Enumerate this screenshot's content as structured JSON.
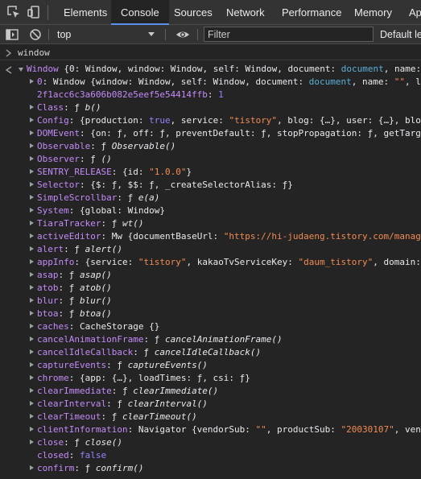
{
  "tabs": {
    "elements": "Elements",
    "console": "Console",
    "sources": "Sources",
    "network": "Network",
    "performance": "Performance",
    "memory": "Memory",
    "application": "Ap"
  },
  "toolbar": {
    "context": "top",
    "filter_placeholder": "Filter",
    "levels": "Default le"
  },
  "command": "window",
  "rows": [
    {
      "indent": 0,
      "arrow": "down",
      "segments": [
        [
          "kd",
          "Window "
        ],
        [
          "p",
          "{0: Window, window: Window, self: Window, document: "
        ],
        [
          "kw",
          "document"
        ],
        [
          "p",
          ", name: "
        ]
      ]
    },
    {
      "indent": 1,
      "arrow": "right",
      "segments": [
        [
          "kd",
          "0"
        ],
        [
          "p",
          ": Window {window: Window, self: Window, document: "
        ],
        [
          "kw",
          "document"
        ],
        [
          "p",
          ", name: "
        ],
        [
          "s",
          "\"\""
        ],
        [
          "p",
          ", lo"
        ]
      ]
    },
    {
      "indent": 1,
      "arrow": "",
      "segments": [
        [
          "kd",
          "2f1acc6c3a606b082e5eef5e54414ffb"
        ],
        [
          "p",
          ": "
        ],
        [
          "n",
          "1"
        ]
      ]
    },
    {
      "indent": 1,
      "arrow": "right",
      "segments": [
        [
          "kd",
          "Class"
        ],
        [
          "p",
          ": ƒ "
        ],
        [
          "f",
          "b()"
        ]
      ]
    },
    {
      "indent": 1,
      "arrow": "right",
      "segments": [
        [
          "kd",
          "Config"
        ],
        [
          "p",
          ": {production: "
        ],
        [
          "n",
          "true"
        ],
        [
          "p",
          ", service: "
        ],
        [
          "s",
          "\"tistory\""
        ],
        [
          "p",
          ", blog: {…}, user: {…}, blog"
        ]
      ]
    },
    {
      "indent": 1,
      "arrow": "right",
      "segments": [
        [
          "kd",
          "DOMEvent"
        ],
        [
          "p",
          ": {on: ƒ, off: ƒ, preventDefault: ƒ, stopPropagation: ƒ, getTarge"
        ]
      ]
    },
    {
      "indent": 1,
      "arrow": "right",
      "segments": [
        [
          "kd",
          "Observable"
        ],
        [
          "p",
          ": ƒ "
        ],
        [
          "f",
          "Observable()"
        ]
      ]
    },
    {
      "indent": 1,
      "arrow": "right",
      "segments": [
        [
          "kd",
          "Observer"
        ],
        [
          "p",
          ": ƒ "
        ],
        [
          "f",
          "()"
        ]
      ]
    },
    {
      "indent": 1,
      "arrow": "right",
      "segments": [
        [
          "kd",
          "SENTRY_RELEASE"
        ],
        [
          "p",
          ": {id: "
        ],
        [
          "s",
          "\"1.0.0\""
        ],
        [
          "p",
          "}"
        ]
      ]
    },
    {
      "indent": 1,
      "arrow": "right",
      "segments": [
        [
          "kd",
          "Selector"
        ],
        [
          "p",
          ": {$: ƒ, $$: ƒ, _createSelectorAlias: ƒ}"
        ]
      ]
    },
    {
      "indent": 1,
      "arrow": "right",
      "segments": [
        [
          "kd",
          "SimpleScrollbar"
        ],
        [
          "p",
          ": ƒ "
        ],
        [
          "f",
          "e(a)"
        ]
      ]
    },
    {
      "indent": 1,
      "arrow": "right",
      "segments": [
        [
          "kd",
          "System"
        ],
        [
          "p",
          ": {global: Window}"
        ]
      ]
    },
    {
      "indent": 1,
      "arrow": "right",
      "segments": [
        [
          "kd",
          "TiaraTracker"
        ],
        [
          "p",
          ": ƒ "
        ],
        [
          "f",
          "wt()"
        ]
      ]
    },
    {
      "indent": 1,
      "arrow": "right",
      "segments": [
        [
          "kd",
          "activeEditor"
        ],
        [
          "p",
          ": Mw {documentBaseUrl: "
        ],
        [
          "s",
          "\"https://hi-judaeng.tistory.com/manage"
        ]
      ]
    },
    {
      "indent": 1,
      "arrow": "right",
      "segments": [
        [
          "kd",
          "alert"
        ],
        [
          "p",
          ": ƒ "
        ],
        [
          "f",
          "alert()"
        ]
      ]
    },
    {
      "indent": 1,
      "arrow": "right",
      "segments": [
        [
          "kd",
          "appInfo"
        ],
        [
          "p",
          ": {service: "
        ],
        [
          "s",
          "\"tistory\""
        ],
        [
          "p",
          ", kakaoTvServiceKey: "
        ],
        [
          "s",
          "\"daum_tistory\""
        ],
        [
          "p",
          ", domain:"
        ]
      ]
    },
    {
      "indent": 1,
      "arrow": "right",
      "segments": [
        [
          "kd",
          "asap"
        ],
        [
          "p",
          ": ƒ "
        ],
        [
          "f",
          "asap()"
        ]
      ]
    },
    {
      "indent": 1,
      "arrow": "right",
      "segments": [
        [
          "kd",
          "atob"
        ],
        [
          "p",
          ": ƒ "
        ],
        [
          "f",
          "atob()"
        ]
      ]
    },
    {
      "indent": 1,
      "arrow": "right",
      "segments": [
        [
          "kd",
          "blur"
        ],
        [
          "p",
          ": ƒ "
        ],
        [
          "f",
          "blur()"
        ]
      ]
    },
    {
      "indent": 1,
      "arrow": "right",
      "segments": [
        [
          "kd",
          "btoa"
        ],
        [
          "p",
          ": ƒ "
        ],
        [
          "f",
          "btoa()"
        ]
      ]
    },
    {
      "indent": 1,
      "arrow": "right",
      "segments": [
        [
          "kd",
          "caches"
        ],
        [
          "p",
          ": CacheStorage {}"
        ]
      ]
    },
    {
      "indent": 1,
      "arrow": "right",
      "segments": [
        [
          "kd",
          "cancelAnimationFrame"
        ],
        [
          "p",
          ": ƒ "
        ],
        [
          "f",
          "cancelAnimationFrame()"
        ]
      ]
    },
    {
      "indent": 1,
      "arrow": "right",
      "segments": [
        [
          "kd",
          "cancelIdleCallback"
        ],
        [
          "p",
          ": ƒ "
        ],
        [
          "f",
          "cancelIdleCallback()"
        ]
      ]
    },
    {
      "indent": 1,
      "arrow": "right",
      "segments": [
        [
          "kd",
          "captureEvents"
        ],
        [
          "p",
          ": ƒ "
        ],
        [
          "f",
          "captureEvents()"
        ]
      ]
    },
    {
      "indent": 1,
      "arrow": "right",
      "segments": [
        [
          "kd",
          "chrome"
        ],
        [
          "p",
          ": {app: {…}, loadTimes: ƒ, csi: ƒ}"
        ]
      ]
    },
    {
      "indent": 1,
      "arrow": "right",
      "segments": [
        [
          "kd",
          "clearImmediate"
        ],
        [
          "p",
          ": ƒ "
        ],
        [
          "f",
          "clearImmediate()"
        ]
      ]
    },
    {
      "indent": 1,
      "arrow": "right",
      "segments": [
        [
          "kd",
          "clearInterval"
        ],
        [
          "p",
          ": ƒ "
        ],
        [
          "f",
          "clearInterval()"
        ]
      ]
    },
    {
      "indent": 1,
      "arrow": "right",
      "segments": [
        [
          "kd",
          "clearTimeout"
        ],
        [
          "p",
          ": ƒ "
        ],
        [
          "f",
          "clearTimeout()"
        ]
      ]
    },
    {
      "indent": 1,
      "arrow": "right",
      "segments": [
        [
          "kd",
          "clientInformation"
        ],
        [
          "p",
          ": Navigator {vendorSub: "
        ],
        [
          "s",
          "\"\""
        ],
        [
          "p",
          ", productSub: "
        ],
        [
          "s",
          "\"20030107\""
        ],
        [
          "p",
          ", vend"
        ]
      ]
    },
    {
      "indent": 1,
      "arrow": "right",
      "segments": [
        [
          "kd",
          "close"
        ],
        [
          "p",
          ": ƒ "
        ],
        [
          "f",
          "close()"
        ]
      ]
    },
    {
      "indent": 1,
      "arrow": "",
      "segments": [
        [
          "kd",
          "closed"
        ],
        [
          "p",
          ": "
        ],
        [
          "n",
          "false"
        ]
      ]
    },
    {
      "indent": 1,
      "arrow": "right",
      "segments": [
        [
          "kd",
          "confirm"
        ],
        [
          "p",
          ": ƒ "
        ],
        [
          "f",
          "confirm()"
        ]
      ]
    }
  ],
  "colors": {
    "background": "#242424",
    "tabbar": "#333333",
    "accent": "#5a91f1",
    "key": "#c58af9",
    "string": "#f28b54",
    "number": "#9980ff",
    "link": "#5db0d7"
  },
  "icons": [
    "inspect-element-icon",
    "device-toolbar-icon",
    "sidebar-toggle-icon",
    "clear-console-icon",
    "eye-icon",
    "prompt-chevron-icon",
    "return-arrow-icon"
  ]
}
